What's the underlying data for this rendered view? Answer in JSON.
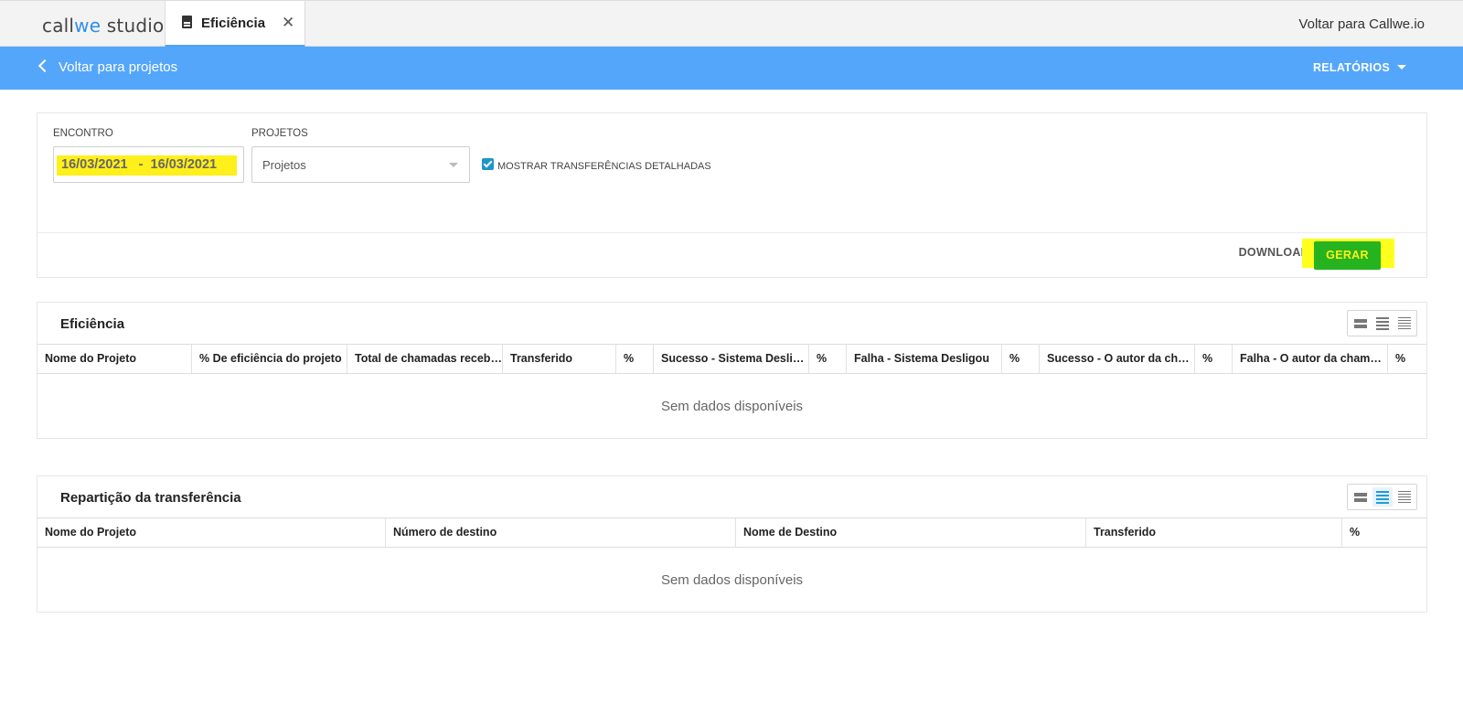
{
  "topbar": {
    "logo_pre": "call",
    "logo_mark": "we",
    "logo_post": " studio",
    "tab_label": "Eficiência",
    "tab_close": "✕",
    "back_link": "Voltar para Callwe.io"
  },
  "subbar": {
    "back_label": "Voltar para projetos",
    "reports_label": "RELATÓRIOS"
  },
  "filters": {
    "date_label": "ENCONTRO",
    "date_range": "16/03/2021   -  16/03/2021",
    "projects_label": "PROJETOS",
    "projects_placeholder": "Projetos",
    "detailed_transfers_label": "MOSTRAR TRANSFERÊNCIAS DETALHADAS",
    "detailed_transfers_checked": true,
    "download_label": "DOWNLOAD",
    "generate_label": "GERAR"
  },
  "efficiency_grid": {
    "title": "Eficiência",
    "columns": [
      "Nome do Projeto",
      "% De eficiência do projeto",
      "Total de chamadas recebidas",
      "Transferido",
      "%",
      "Sucesso - Sistema Desligou",
      "%",
      "Falha - Sistema Desligou",
      "%",
      "Sucesso - O autor da chamada",
      "%",
      "Falha - O autor da chamada",
      "%"
    ],
    "empty_text": "Sem dados disponíveis",
    "active_density": "compact"
  },
  "transfer_grid": {
    "title": "Repartição da transferência",
    "columns": [
      "Nome do Projeto",
      "Número de destino",
      "Nome de Destino",
      "Transferido",
      "%"
    ],
    "empty_text": "Sem dados disponíveis",
    "active_density": "standard"
  },
  "colors": {
    "blue_bar": "#54a6fb",
    "generate_button": "#25b41f",
    "highlight": "#ffef1a"
  }
}
